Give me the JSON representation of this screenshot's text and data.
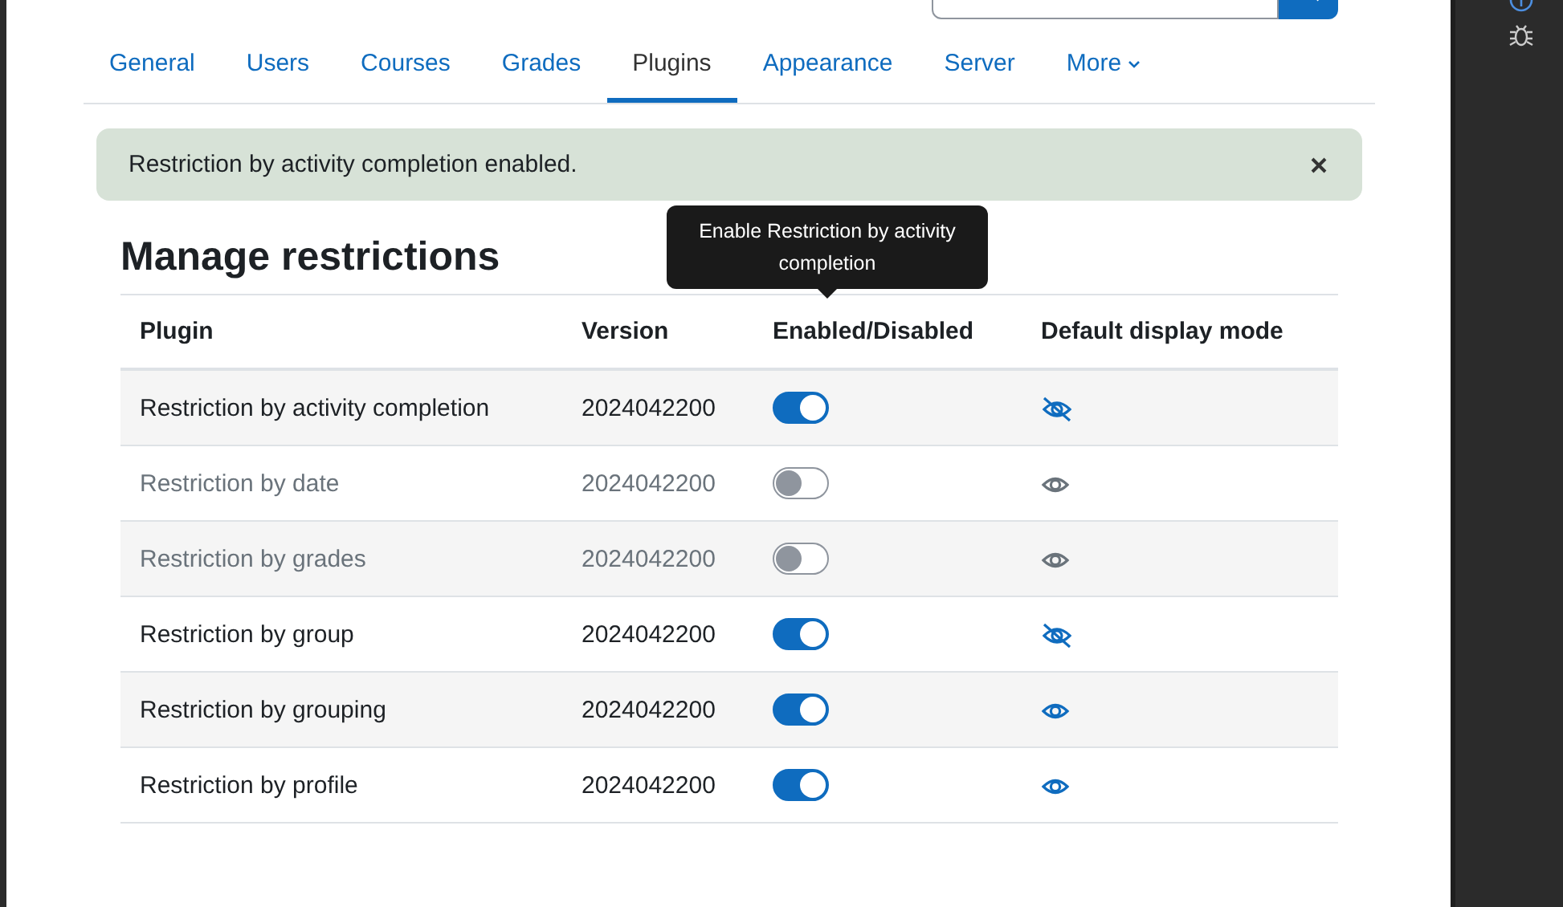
{
  "tabs": [
    {
      "label": "General",
      "selected": false
    },
    {
      "label": "Users",
      "selected": false
    },
    {
      "label": "Courses",
      "selected": false
    },
    {
      "label": "Grades",
      "selected": false
    },
    {
      "label": "Plugins",
      "selected": true
    },
    {
      "label": "Appearance",
      "selected": false
    },
    {
      "label": "Server",
      "selected": false
    },
    {
      "label": "More",
      "selected": false,
      "kind": "dropdown"
    }
  ],
  "alert": {
    "message": "Restriction by activity completion enabled."
  },
  "heading": "Manage restrictions",
  "tooltip": "Enable Restriction by activity completion",
  "table": {
    "columns": [
      "Plugin",
      "Version",
      "Enabled/Disabled",
      "Default display mode"
    ],
    "rows": [
      {
        "plugin": "Restriction by activity completion",
        "version": "2024042200",
        "enabled": true,
        "kind": "hidden"
      },
      {
        "plugin": "Restriction by date",
        "version": "2024042200",
        "enabled": false,
        "kind": "shown"
      },
      {
        "plugin": "Restriction by grades",
        "version": "2024042200",
        "enabled": false,
        "kind": "shown"
      },
      {
        "plugin": "Restriction by group",
        "version": "2024042200",
        "enabled": true,
        "kind": "hidden"
      },
      {
        "plugin": "Restriction by grouping",
        "version": "2024042200",
        "enabled": true,
        "kind": "shown"
      },
      {
        "plugin": "Restriction by profile",
        "version": "2024042200",
        "enabled": true,
        "kind": "shown"
      }
    ]
  }
}
